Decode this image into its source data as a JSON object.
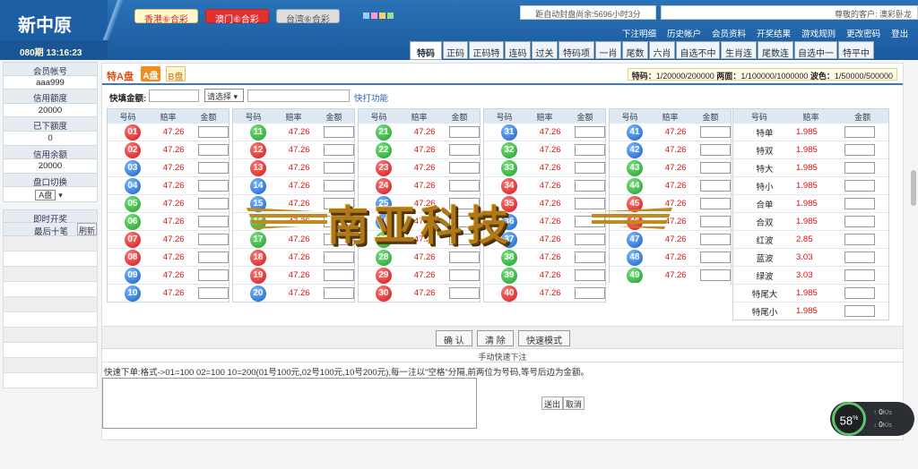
{
  "header": {
    "brand": "新中原",
    "period": "080期 13:16:23",
    "region_tabs": [
      "香港⑥合彩",
      "澳门⑥合彩",
      "台湾⑥合彩"
    ],
    "countdown": "距自动封盘尚余:5696小时3分",
    "greeting": "尊敬的客户: 澳彩卧龙",
    "nav": [
      "下注明细",
      "历史帐户",
      "会员资料",
      "开奖结果",
      "游戏规则",
      "更改密码",
      "登出"
    ]
  },
  "tabs": [
    "特码",
    "正码",
    "正码特",
    "连码",
    "过关",
    "特码项",
    "一肖",
    "尾数",
    "六肖",
    "自选不中",
    "生肖连",
    "尾数连",
    "自选中一",
    "特平中"
  ],
  "sidebar": {
    "rows": [
      {
        "label": "会员帐号",
        "value": "aaa999"
      },
      {
        "label": "信用额度",
        "value": "20000"
      },
      {
        "label": "已下额度",
        "value": "0"
      },
      {
        "label": "信用余额",
        "value": "20000"
      }
    ],
    "pan_label": "盘口切换",
    "pan_value": "A盘",
    "live": "即时开奖",
    "last10": "最后十笔",
    "refresh": "刷新"
  },
  "panel": {
    "title": "特A盘",
    "btn_a": "A盘",
    "btn_b": "B盘",
    "odds_label_1": "特码：",
    "odds_value_1": "1/20000/200000",
    "odds_label_2": "两面：",
    "odds_value_2": "1/100000/1000000",
    "odds_label_3": "波色：",
    "odds_value_3": "1/50000/500000",
    "quick_label": "快填金额:",
    "quick_select": "请选择",
    "quick_link": "快打功能"
  },
  "grid": {
    "head": [
      "号码",
      "赔率",
      "金额"
    ],
    "rate": "47.26",
    "columns": [
      [
        {
          "n": "01",
          "c": "red"
        },
        {
          "n": "02",
          "c": "red"
        },
        {
          "n": "03",
          "c": "blue"
        },
        {
          "n": "04",
          "c": "blue"
        },
        {
          "n": "05",
          "c": "green"
        },
        {
          "n": "06",
          "c": "green"
        },
        {
          "n": "07",
          "c": "red"
        },
        {
          "n": "08",
          "c": "red"
        },
        {
          "n": "09",
          "c": "blue"
        },
        {
          "n": "10",
          "c": "blue"
        }
      ],
      [
        {
          "n": "11",
          "c": "green"
        },
        {
          "n": "12",
          "c": "red"
        },
        {
          "n": "13",
          "c": "red"
        },
        {
          "n": "14",
          "c": "blue"
        },
        {
          "n": "15",
          "c": "blue"
        },
        {
          "n": "16",
          "c": "green"
        },
        {
          "n": "17",
          "c": "green"
        },
        {
          "n": "18",
          "c": "red"
        },
        {
          "n": "19",
          "c": "red"
        },
        {
          "n": "20",
          "c": "blue"
        }
      ],
      [
        {
          "n": "21",
          "c": "green"
        },
        {
          "n": "22",
          "c": "green"
        },
        {
          "n": "23",
          "c": "red"
        },
        {
          "n": "24",
          "c": "red"
        },
        {
          "n": "25",
          "c": "blue"
        },
        {
          "n": "26",
          "c": "blue"
        },
        {
          "n": "27",
          "c": "green"
        },
        {
          "n": "28",
          "c": "green"
        },
        {
          "n": "29",
          "c": "red"
        },
        {
          "n": "30",
          "c": "red"
        }
      ],
      [
        {
          "n": "31",
          "c": "blue"
        },
        {
          "n": "32",
          "c": "green"
        },
        {
          "n": "33",
          "c": "green"
        },
        {
          "n": "34",
          "c": "red"
        },
        {
          "n": "35",
          "c": "red"
        },
        {
          "n": "36",
          "c": "blue"
        },
        {
          "n": "37",
          "c": "blue"
        },
        {
          "n": "38",
          "c": "green"
        },
        {
          "n": "39",
          "c": "green"
        },
        {
          "n": "40",
          "c": "red"
        }
      ],
      [
        {
          "n": "41",
          "c": "blue"
        },
        {
          "n": "42",
          "c": "blue"
        },
        {
          "n": "43",
          "c": "green"
        },
        {
          "n": "44",
          "c": "green"
        },
        {
          "n": "45",
          "c": "red"
        },
        {
          "n": "46",
          "c": "red"
        },
        {
          "n": "47",
          "c": "blue"
        },
        {
          "n": "48",
          "c": "blue"
        },
        {
          "n": "49",
          "c": "green"
        }
      ]
    ],
    "specials": [
      {
        "label": "特单",
        "rate": "1.985"
      },
      {
        "label": "特双",
        "rate": "1.985"
      },
      {
        "label": "特大",
        "rate": "1.985"
      },
      {
        "label": "特小",
        "rate": "1.985"
      },
      {
        "label": "合单",
        "rate": "1.985"
      },
      {
        "label": "合双",
        "rate": "1.985"
      },
      {
        "label": "红波",
        "rate": "2.85"
      },
      {
        "label": "蓝波",
        "rate": "3.03"
      },
      {
        "label": "绿波",
        "rate": "3.03"
      },
      {
        "label": "特尾大",
        "rate": "1.985"
      },
      {
        "label": "特尾小",
        "rate": "1.985"
      }
    ]
  },
  "actions": {
    "confirm": "确 认",
    "clear": "清 除",
    "fast": "快速模式"
  },
  "manual": {
    "title": "手动快速下注",
    "desc": "快速下单:格式->01=100 02=100 10=200(01号100元,02号100元,10号200元),每一注以\"空格\"分隔,前两位为号码,等号后边为金额。",
    "send": "送出",
    "cancel": "取消"
  },
  "watermark": "南亚科技",
  "speed": {
    "percent": "58",
    "up": "0",
    "down": "0",
    "unit": "K/s"
  }
}
